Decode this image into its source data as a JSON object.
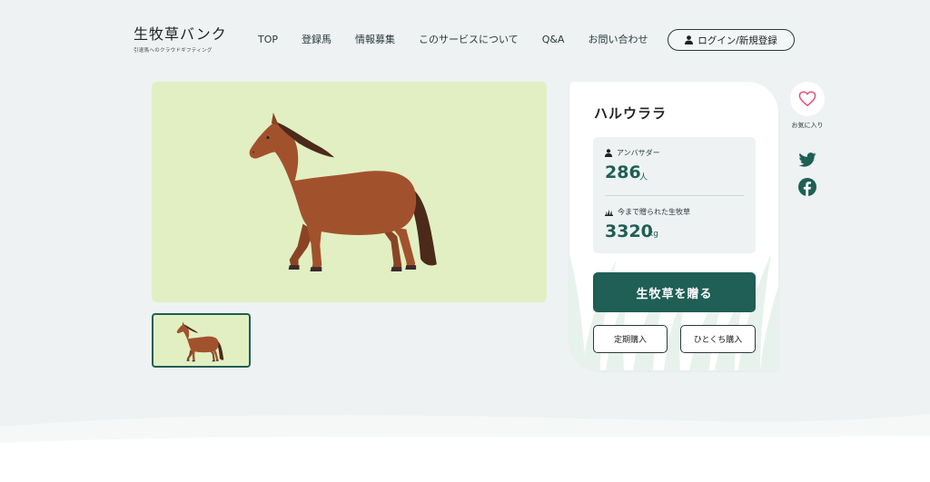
{
  "header": {
    "logo_title": "生牧草バンク",
    "logo_subtitle": "引退馬へのクラウドギフティング",
    "nav": [
      "TOP",
      "登録馬",
      "情報募集",
      "このサービスについて",
      "Q&A",
      "お問い合わせ"
    ],
    "login_label": "ログイン/新規登録"
  },
  "horse": {
    "name": "ハルウララ",
    "ambassador_label": "アンバサダー",
    "ambassador_count": "286",
    "ambassador_unit": "人",
    "grass_label": "今まで贈られた生牧草",
    "grass_amount": "3320",
    "grass_unit": "kg"
  },
  "actions": {
    "gift_label": "生牧草を贈る",
    "subscription_label": "定期購入",
    "single_purchase_label": "ひとくち購入"
  },
  "sidebar": {
    "favorite_label": "お気に入り"
  },
  "colors": {
    "brand_green": "#1f5f55",
    "image_bg": "#e1efc3",
    "page_bg": "#eef2f3",
    "heart": "#e0507a",
    "horse_coat": "#a1522d"
  },
  "icons": [
    "user-icon",
    "grass-icon",
    "heart-icon",
    "twitter-icon",
    "facebook-icon"
  ]
}
